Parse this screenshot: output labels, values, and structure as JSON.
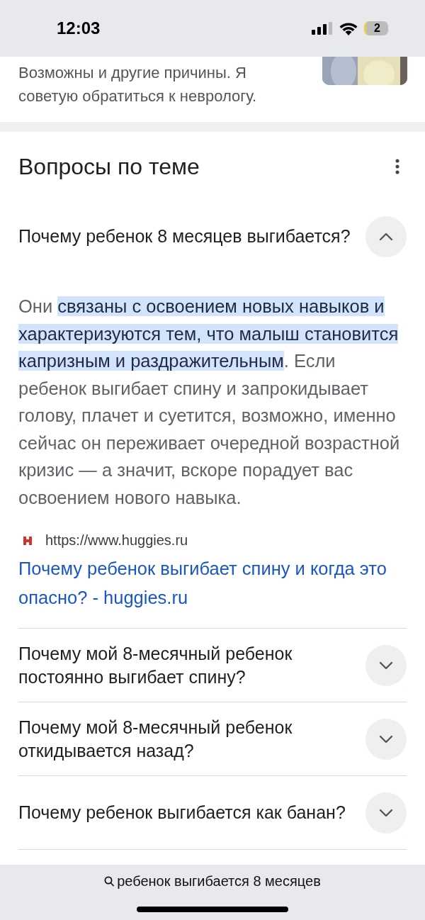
{
  "status_bar": {
    "time": "12:03",
    "battery": "2"
  },
  "snippet": {
    "text": "Возможны и другие причины. Я советую обратиться к неврологу."
  },
  "section": {
    "title": "Вопросы по теме"
  },
  "questions": [
    {
      "question": "Почему ребенок 8 месяцев выгибается?",
      "expanded": true,
      "answer": {
        "before": "Они ",
        "highlight": "связаны с освоением новых навыков и характеризуются тем, что малыш становится капризным и раздражительным",
        "after": ". Если ребенок выгибает спину и запрокидывает голову, плачет и суетится, возможно, именно сейчас он переживает очередной возрастной кризис — а значит, вскоре порадует вас освоением нового навыка."
      },
      "source_url": "https://www.huggies.ru",
      "source_title": "Почему ребенок выгибает спину и когда это опасно? - huggies.ru"
    },
    {
      "question": "Почему мой 8-месячный ребенок постоянно выгибает спину?",
      "expanded": false
    },
    {
      "question": "Почему мой 8-месячный ребенок откидывается назад?",
      "expanded": false
    },
    {
      "question": "Почему ребенок выгибается как банан?",
      "expanded": false
    }
  ],
  "search_bar": {
    "query": "ребенок выгибается 8 месяцев"
  }
}
